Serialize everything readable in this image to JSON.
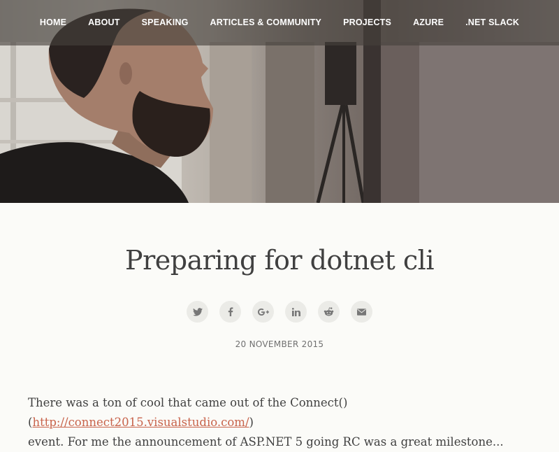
{
  "nav": {
    "items": [
      {
        "label": "HOME"
      },
      {
        "label": "ABOUT"
      },
      {
        "label": "SPEAKING"
      },
      {
        "label": "ARTICLES & COMMUNITY"
      },
      {
        "label": "PROJECTS"
      },
      {
        "label": "AZURE"
      },
      {
        "label": ".NET SLACK"
      }
    ],
    "text_color": "#ffffff"
  },
  "post": {
    "title": "Preparing for dotnet cli",
    "date": "20 NOVEMBER 2015",
    "body": {
      "lead": "There was a ton of cool that came out of the Connect()(",
      "link_text": "http://connect2015.visualstudio.com/",
      "after_link": ")",
      "line2": "event. For me the announcement of ASP.NET 5 going RC was a great milestone..."
    }
  },
  "share": {
    "icons": [
      "twitter-icon",
      "facebook-icon",
      "google-plus-icon",
      "linkedin-icon",
      "reddit-icon",
      "email-icon"
    ]
  },
  "colors": {
    "background": "#fbfbf8",
    "link": "#c8634b",
    "title": "#404040",
    "share_bg": "#ebebe7",
    "icon": "#777777"
  }
}
